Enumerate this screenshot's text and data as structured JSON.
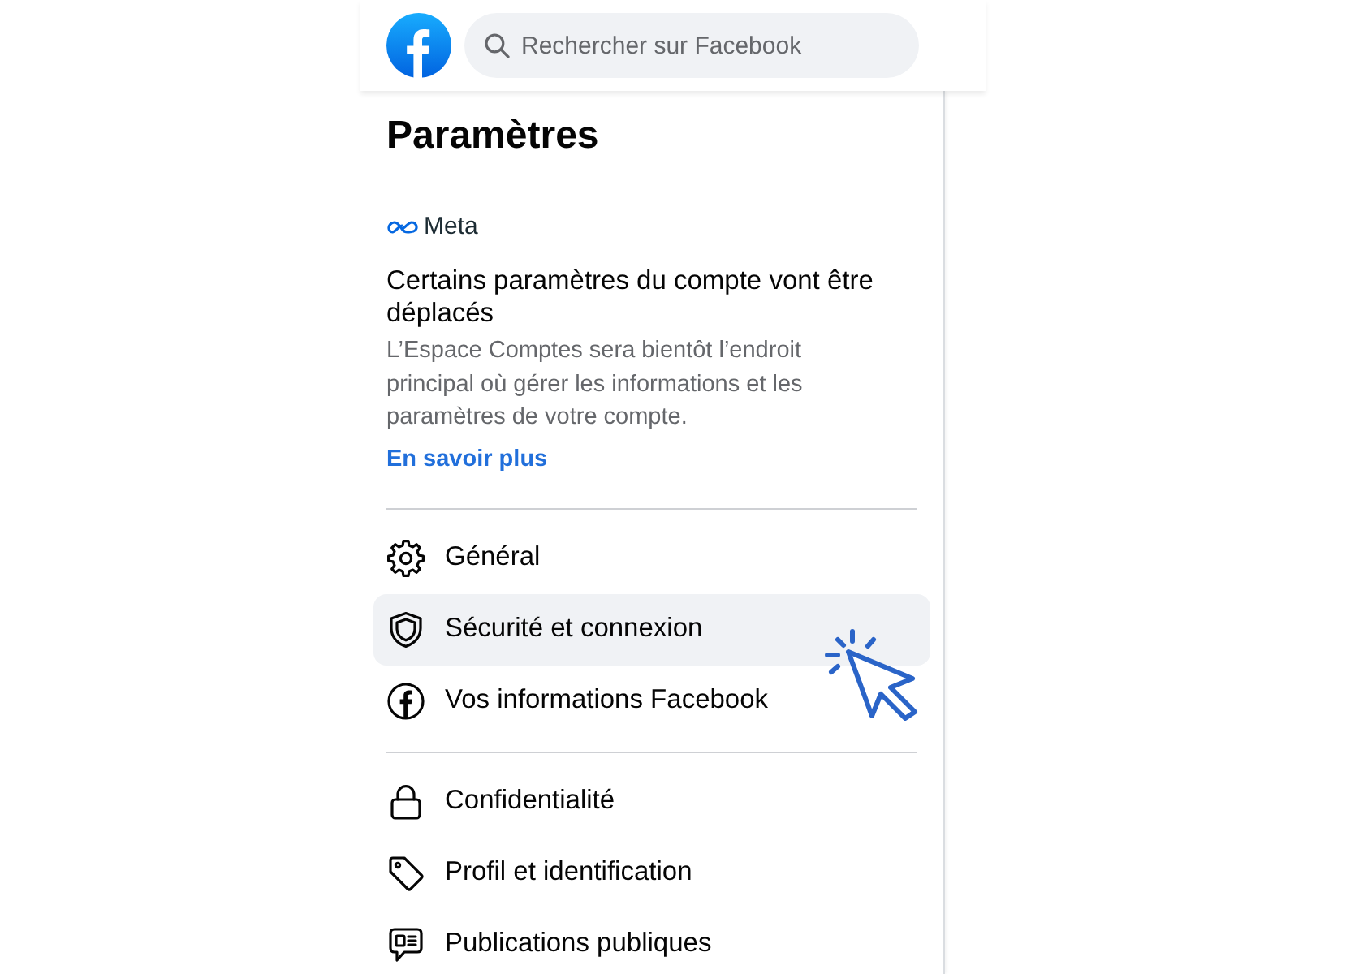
{
  "header": {
    "search": {
      "placeholder": "Rechercher sur Facebook"
    }
  },
  "title": "Paramètres",
  "notice": {
    "brand": "Meta",
    "heading": "Certains paramètres du compte vont être déplacés",
    "body": "L’Espace Comptes sera bientôt l’endroit principal où gérer les informations et les paramètres de votre compte.",
    "link": "En savoir plus"
  },
  "menu_groups": [
    {
      "items": [
        {
          "label": "Général",
          "selected": false
        },
        {
          "label": "Sécurité et connexion",
          "selected": true
        },
        {
          "label": "Vos informations Facebook",
          "selected": false
        }
      ]
    },
    {
      "items": [
        {
          "label": "Confidentialité",
          "selected": false
        },
        {
          "label": "Profil et identification",
          "selected": false
        },
        {
          "label": "Publications publiques",
          "selected": false
        }
      ]
    }
  ]
}
